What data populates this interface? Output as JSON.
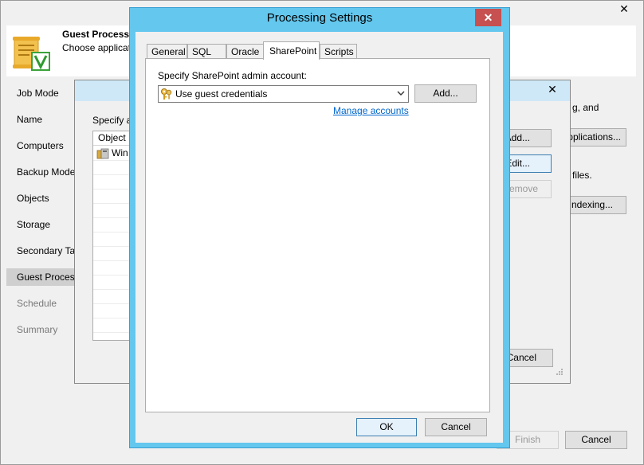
{
  "wizard": {
    "close_glyph": "✕",
    "header_title": "Guest Processi",
    "header_subtitle": "Choose applicati",
    "steps": [
      {
        "label": "Job Mode",
        "state": "normal"
      },
      {
        "label": "Name",
        "state": "normal"
      },
      {
        "label": "Computers",
        "state": "normal"
      },
      {
        "label": "Backup Mode",
        "state": "normal"
      },
      {
        "label": "Objects",
        "state": "normal"
      },
      {
        "label": "Storage",
        "state": "normal"
      },
      {
        "label": "Secondary Ta",
        "state": "normal"
      },
      {
        "label": "Guest Process",
        "state": "active"
      },
      {
        "label": "Schedule",
        "state": "disabled"
      },
      {
        "label": "Summary",
        "state": "disabled"
      }
    ],
    "right_text_1": "g, and",
    "right_text_2": "files.",
    "applications_button": "pplications...",
    "indexing_button": "Indexing...",
    "finish_button": "Finish",
    "cancel_button": "Cancel"
  },
  "mid_dialog": {
    "close_glyph": "✕",
    "prompt": "Specify a",
    "list_header": "Object",
    "list_item": "Win",
    "add_button": "Add...",
    "edit_button": "Edit...",
    "remove_button": "Remove",
    "cancel_button": "Cancel"
  },
  "processing_settings": {
    "title": "Processing Settings",
    "close_glyph": "✕",
    "tabs": [
      "General",
      "SQL",
      "Oracle",
      "SharePoint",
      "Scripts"
    ],
    "active_tab": "SharePoint",
    "admin_label": "Specify SharePoint admin account:",
    "account_selected": "Use guest credentials",
    "add_button": "Add...",
    "manage_link": "Manage accounts",
    "ok_button": "OK",
    "cancel_button": "Cancel"
  },
  "colors": {
    "dialog_frame": "#63c7ee",
    "close_button": "#c75050",
    "link": "#0066cc"
  }
}
